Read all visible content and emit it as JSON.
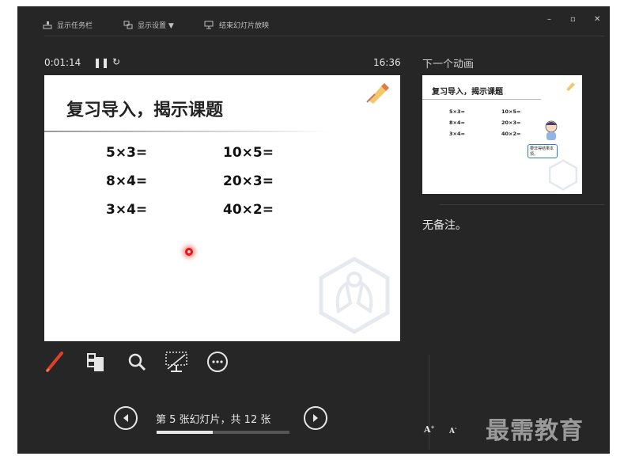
{
  "toolbar": {
    "show_taskbar": "显示任务栏",
    "display_settings": "显示设置 ▼",
    "end_slideshow": "结束幻灯片放映"
  },
  "window_controls": {
    "minimize": "–",
    "restore": "▫",
    "close": "✕"
  },
  "timer": {
    "elapsed": "0:01:14",
    "clock": "16:36"
  },
  "current_slide": {
    "title": "复习导入，揭示课题",
    "equations_left": [
      "5×3=",
      "8×4=",
      "3×4="
    ],
    "equations_right": [
      "10×5=",
      "20×3=",
      "40×2="
    ]
  },
  "next_panel": {
    "heading": "下一个动画",
    "thumb_title": "复习导入，揭示课题",
    "thumb_left": [
      "5×3=",
      "8×4=",
      "3×4="
    ],
    "thumb_right": [
      "10×5=",
      "20×3=",
      "40×2="
    ],
    "thumb_bubble": "要非得结果本领。"
  },
  "notes": {
    "text": "无备注。"
  },
  "navigation": {
    "counter": "第 5 张幻灯片，共 12 张",
    "progress": 0.42
  },
  "font_controls": {
    "increase": "A",
    "decrease": "A"
  },
  "watermark": "最需教育",
  "colors": {
    "background": "#262626",
    "pen_accent": "#e0402a",
    "text": "#e6e6e6",
    "slide": "#ffffff"
  },
  "tools": [
    "pen-icon",
    "slides-grid-icon",
    "magnifier-icon",
    "screen-off-icon",
    "more-options-icon"
  ]
}
